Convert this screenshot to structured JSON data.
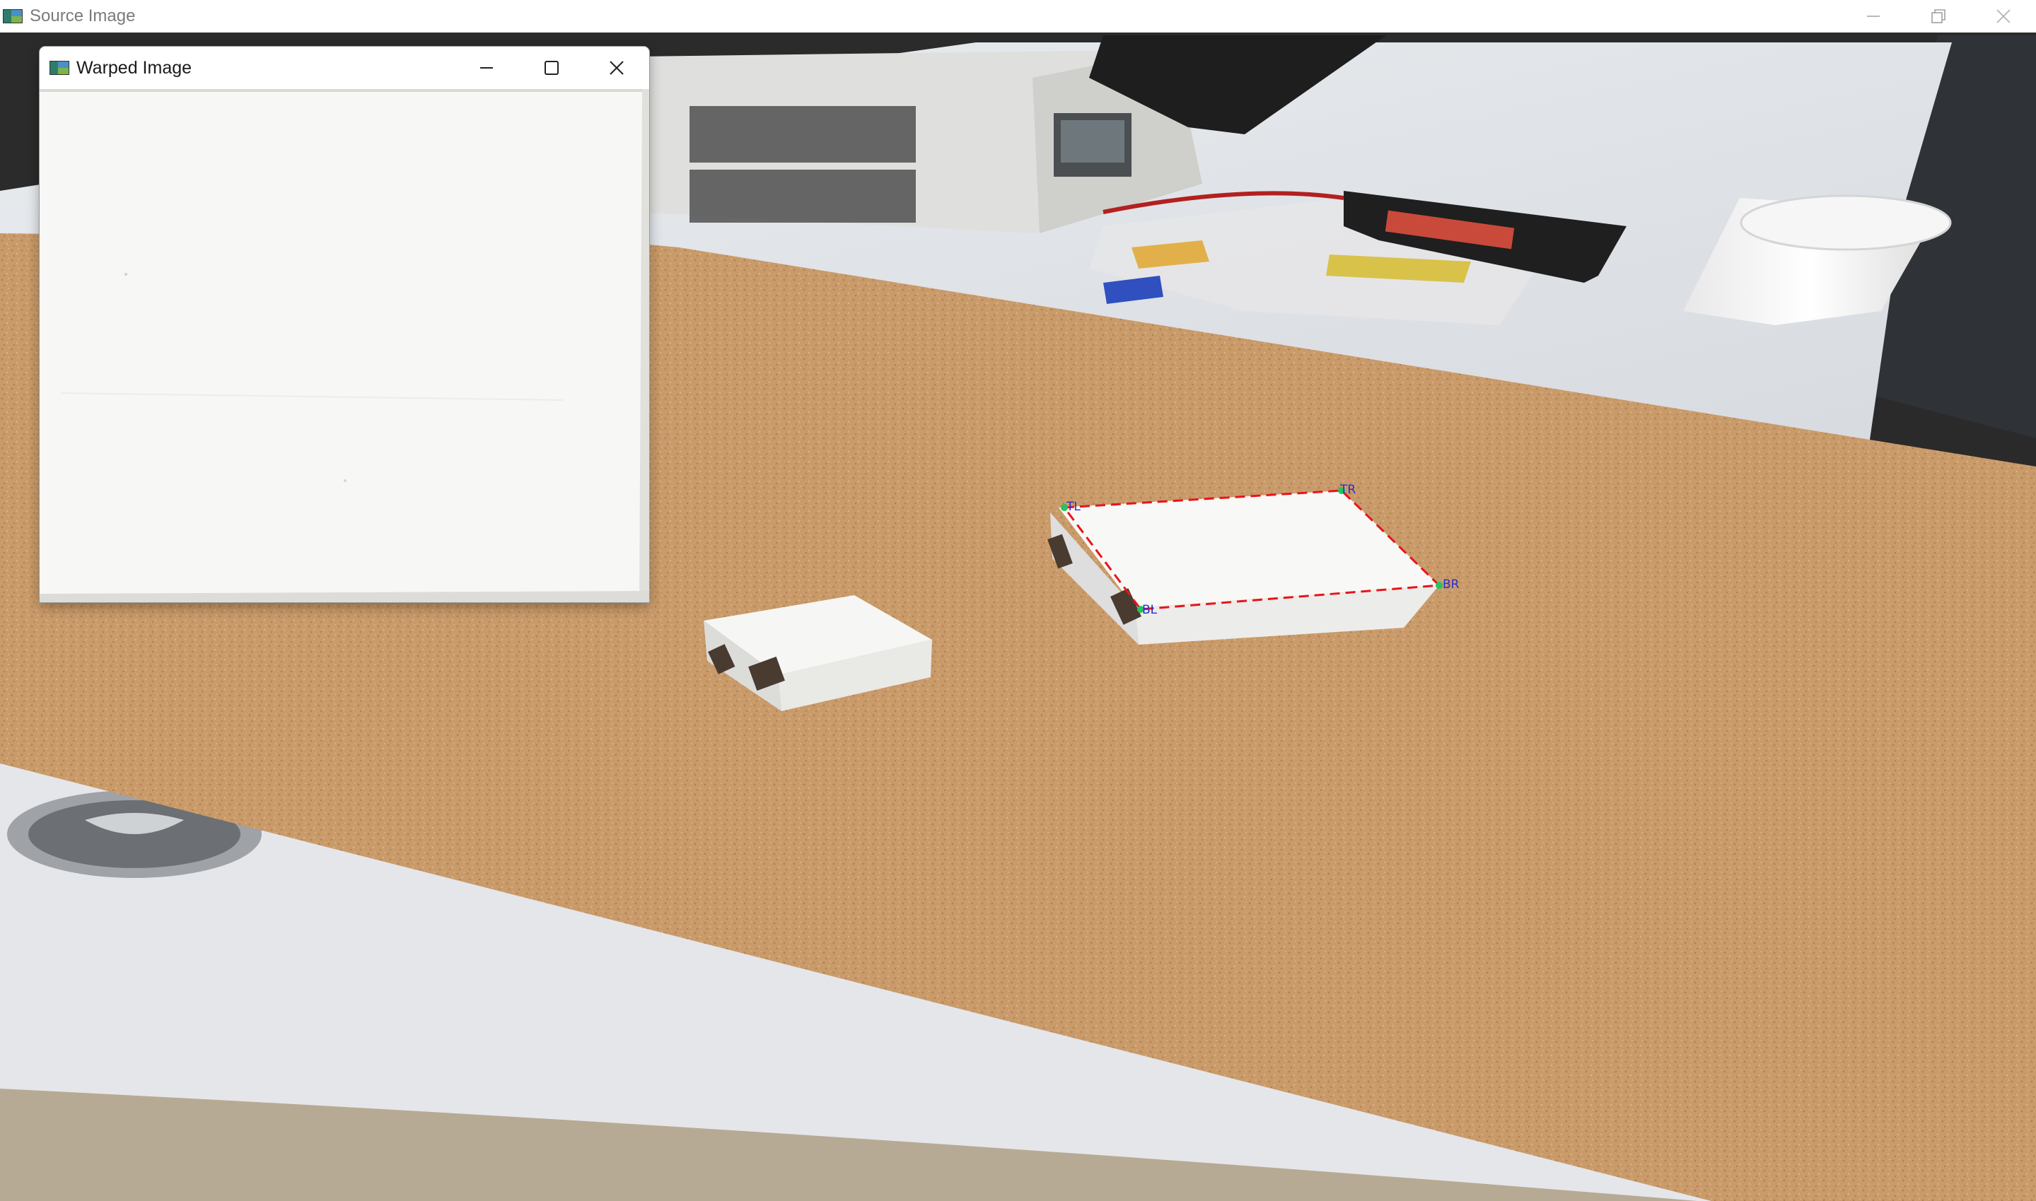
{
  "source_window": {
    "title": "Source Image",
    "icons": {
      "app": "image-viewer-icon",
      "minimize": "minimize-icon",
      "restore": "restore-icon",
      "close": "close-icon"
    }
  },
  "warped_window": {
    "title": "Warped Image",
    "icons": {
      "app": "image-viewer-icon",
      "minimize": "minimize-icon",
      "maximize": "maximize-icon",
      "close": "close-icon"
    }
  },
  "detection": {
    "corner_labels": [
      "TL",
      "TR",
      "BR",
      "BL"
    ],
    "outline_color": "#e8141b",
    "corner_point_color": "#22c55e",
    "label_color": "#2b2bd6"
  },
  "colors": {
    "cork": "#c99a6a",
    "desk": "#e3e6ea",
    "box": "#f4f4f2"
  }
}
